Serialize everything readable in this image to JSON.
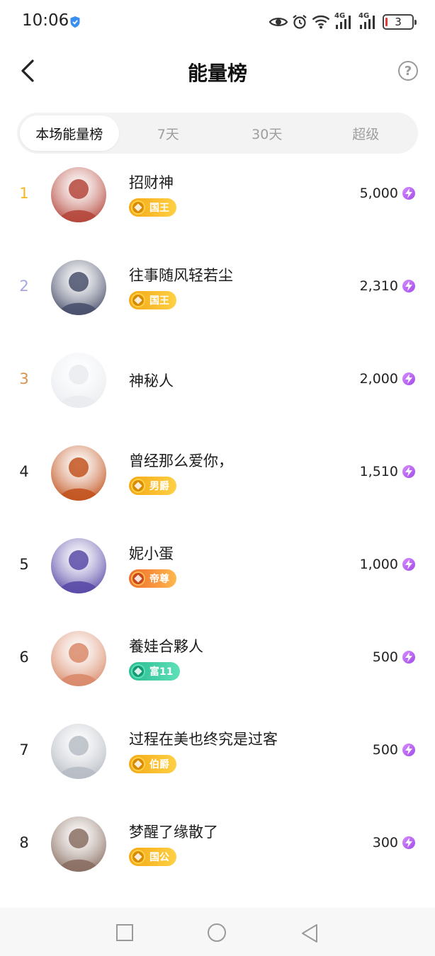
{
  "status_bar": {
    "time": "10:06",
    "network_1": "4G",
    "network_2": "4G",
    "battery": "3"
  },
  "header": {
    "title": "能量榜",
    "help_label": "?"
  },
  "tabs": [
    {
      "label": "本场能量榜",
      "active": true
    },
    {
      "label": "7天",
      "active": false
    },
    {
      "label": "30天",
      "active": false
    },
    {
      "label": "超级",
      "active": false
    }
  ],
  "colors": {
    "rank_gold": "#f6b61e",
    "rank_silver": "#a6a7e0",
    "rank_bronze": "#d6934f",
    "badge_gold": "#f4a916",
    "badge_orange": "#ef6c2c",
    "badge_green": "#2bbd93",
    "energy_purple": "#a24be8"
  },
  "leaderboard": [
    {
      "rank": "1",
      "name": "招财神",
      "badge": "国王",
      "badge_style": "gold",
      "value": "5,000",
      "avatar_color": "#b5473c"
    },
    {
      "rank": "2",
      "name": "往事随风轻若尘",
      "badge": "国王",
      "badge_style": "gold",
      "value": "2,310",
      "avatar_color": "#49506b"
    },
    {
      "rank": "3",
      "name": "神秘人",
      "badge": "",
      "badge_style": "none",
      "value": "2,000",
      "avatar_color": "#e9ebef"
    },
    {
      "rank": "4",
      "name": "曾经那么爱你，",
      "badge": "男爵",
      "badge_style": "gold",
      "value": "1,510",
      "avatar_color": "#c2541f"
    },
    {
      "rank": "5",
      "name": "妮小蛋",
      "badge": "帝尊",
      "badge_style": "orange",
      "value": "1,000",
      "avatar_color": "#5a4aa7"
    },
    {
      "rank": "6",
      "name": "養娃合夥人",
      "badge": "富11",
      "badge_style": "green",
      "value": "500",
      "avatar_color": "#d98a6a"
    },
    {
      "rank": "7",
      "name": "过程在美也终究是过客",
      "badge": "伯爵",
      "badge_style": "gold",
      "value": "500",
      "avatar_color": "#b7bcc4"
    },
    {
      "rank": "8",
      "name": "梦醒了缘散了",
      "badge": "国公",
      "badge_style": "gold",
      "value": "300",
      "avatar_color": "#8a6f63"
    }
  ]
}
